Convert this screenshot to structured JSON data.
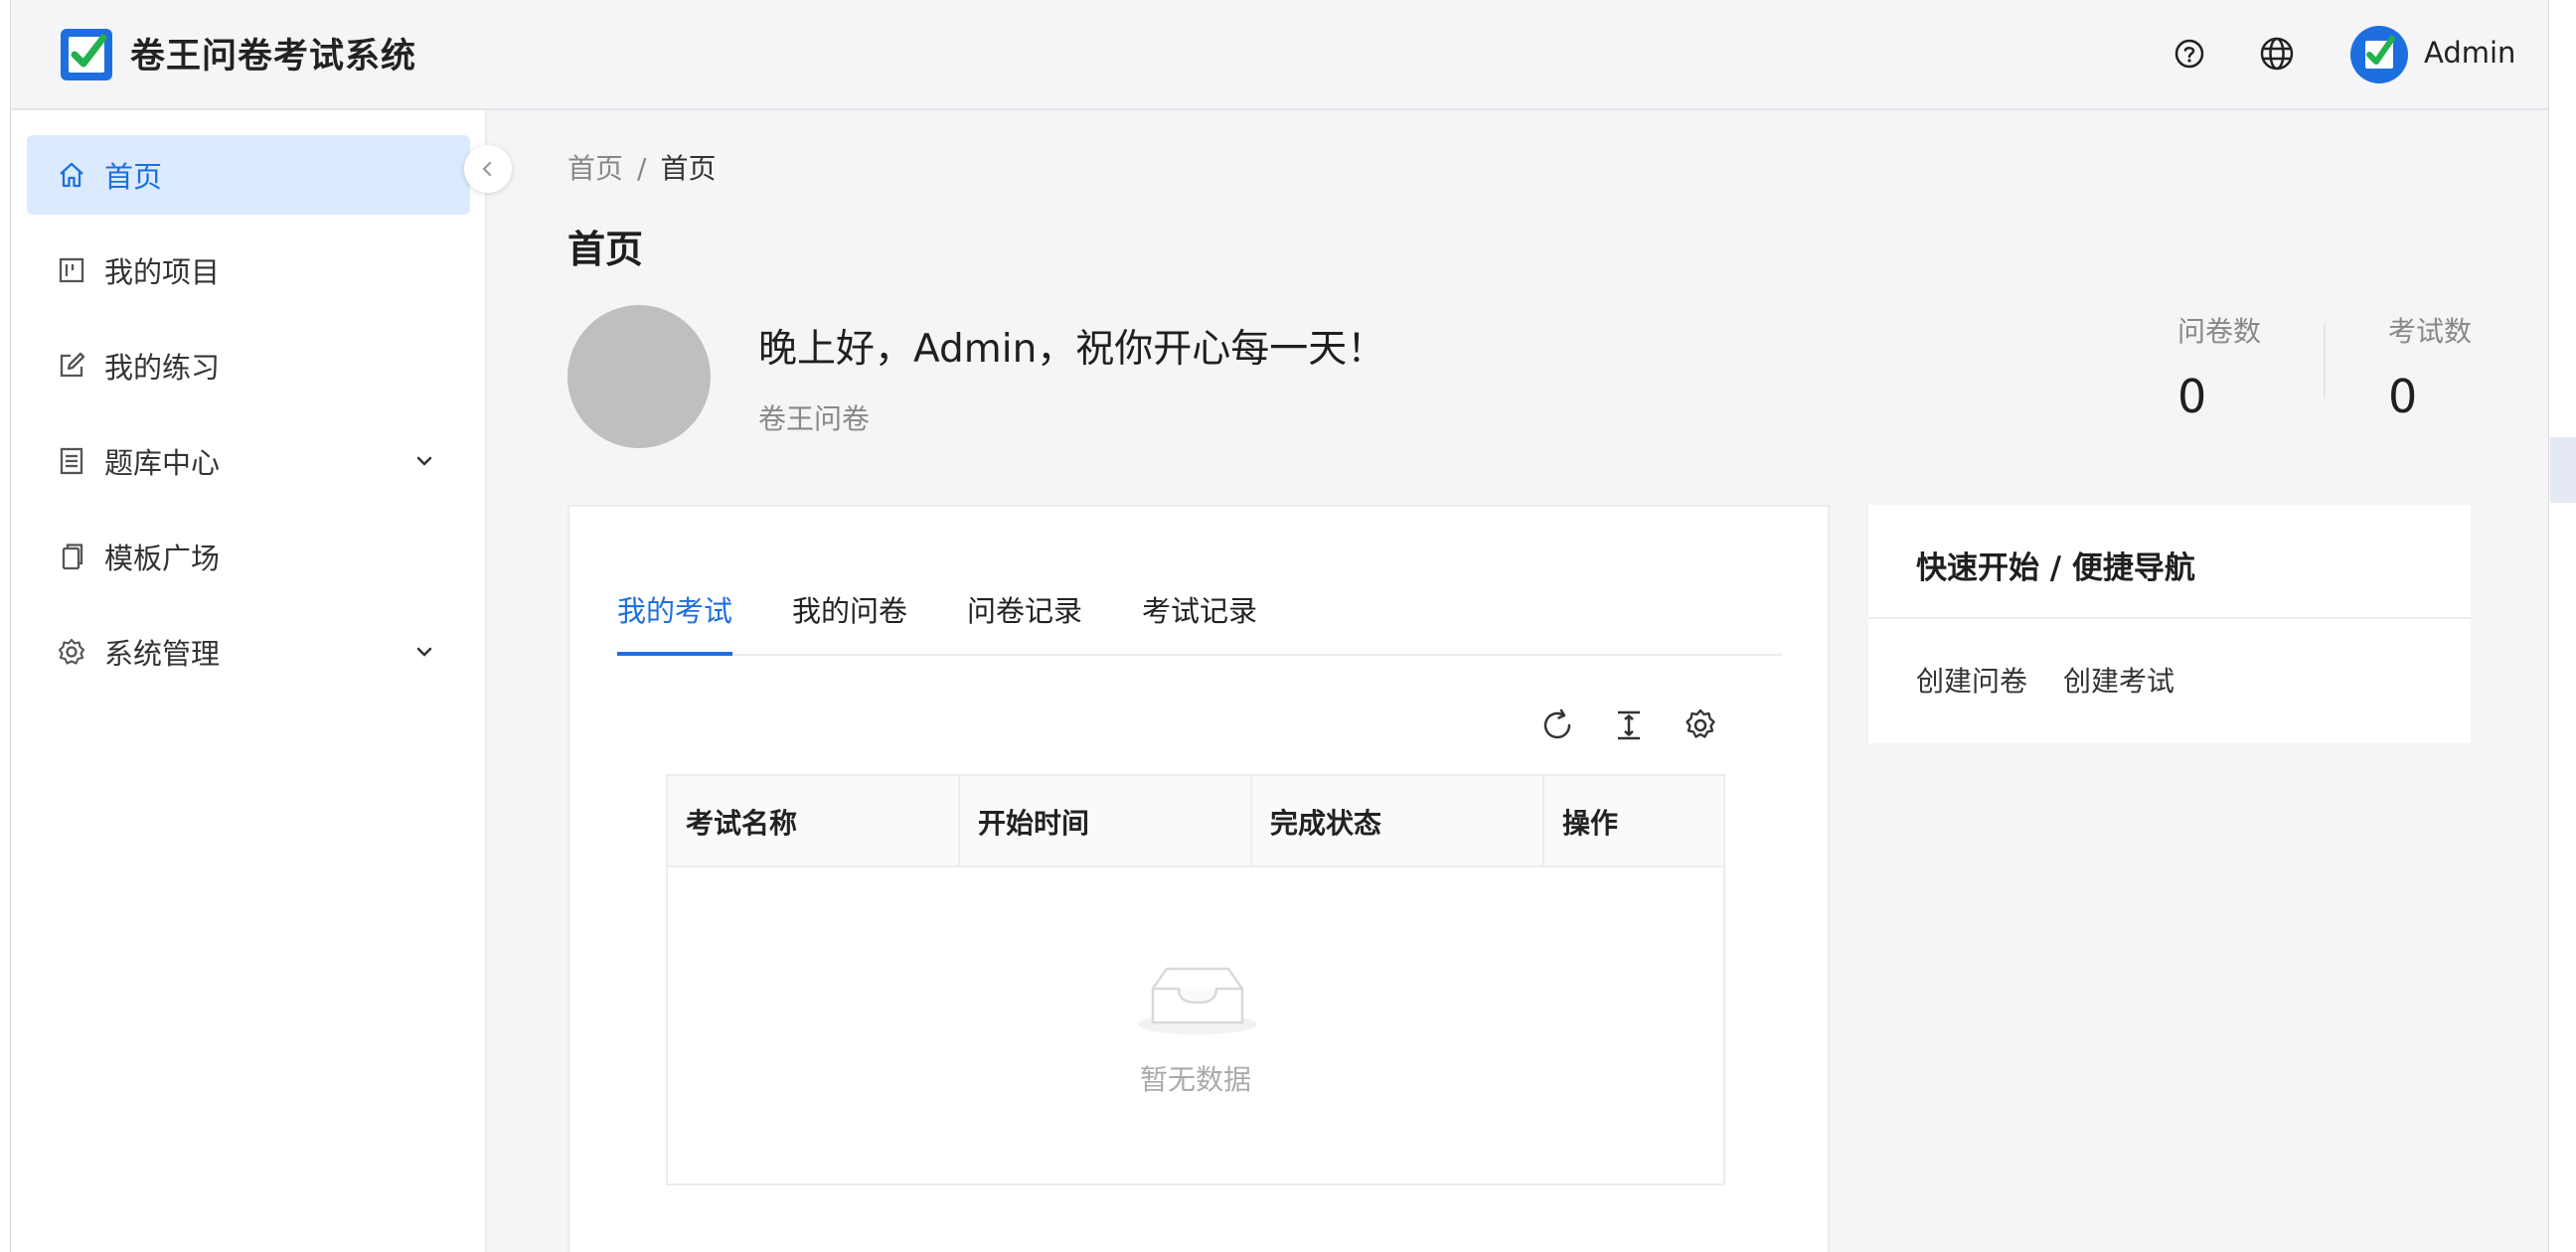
{
  "header": {
    "app_title": "卷王问卷考试系统",
    "user_name": "Admin",
    "colors": {
      "brand_blue": "#1d6fe0",
      "brand_green": "#22b14c"
    },
    "icons": [
      "logo-icon",
      "help-icon",
      "globe-icon",
      "user-avatar-icon"
    ]
  },
  "sidebar": {
    "items": [
      {
        "label": "首页",
        "icon": "home-icon",
        "active": true
      },
      {
        "label": "我的项目",
        "icon": "project-icon"
      },
      {
        "label": "我的练习",
        "icon": "edit-icon"
      },
      {
        "label": "题库中心",
        "icon": "question-bank-icon",
        "expandable": true
      },
      {
        "label": "模板广场",
        "icon": "template-icon"
      },
      {
        "label": "系统管理",
        "icon": "settings-icon",
        "expandable": true
      }
    ]
  },
  "breadcrumb": {
    "root": "首页",
    "separator": "/",
    "current": "首页"
  },
  "page_title": "首页",
  "profile": {
    "greeting": "晚上好，Admin，祝你开心每一天！",
    "subtitle": "卷王问卷"
  },
  "stats": [
    {
      "label": "问卷数",
      "value": "0"
    },
    {
      "label": "考试数",
      "value": "0"
    }
  ],
  "tabs": [
    {
      "label": "我的考试",
      "active": true
    },
    {
      "label": "我的问卷"
    },
    {
      "label": "问卷记录"
    },
    {
      "label": "考试记录"
    }
  ],
  "table": {
    "toolbar_icons": [
      "refresh-icon",
      "density-icon",
      "column-settings-icon"
    ],
    "columns": [
      "考试名称",
      "开始时间",
      "完成状态",
      "操作"
    ],
    "rows": [],
    "empty_text": "暂无数据"
  },
  "quick_nav": {
    "title": "快速开始 / 便捷导航",
    "links": [
      "创建问卷",
      "创建考试"
    ]
  }
}
